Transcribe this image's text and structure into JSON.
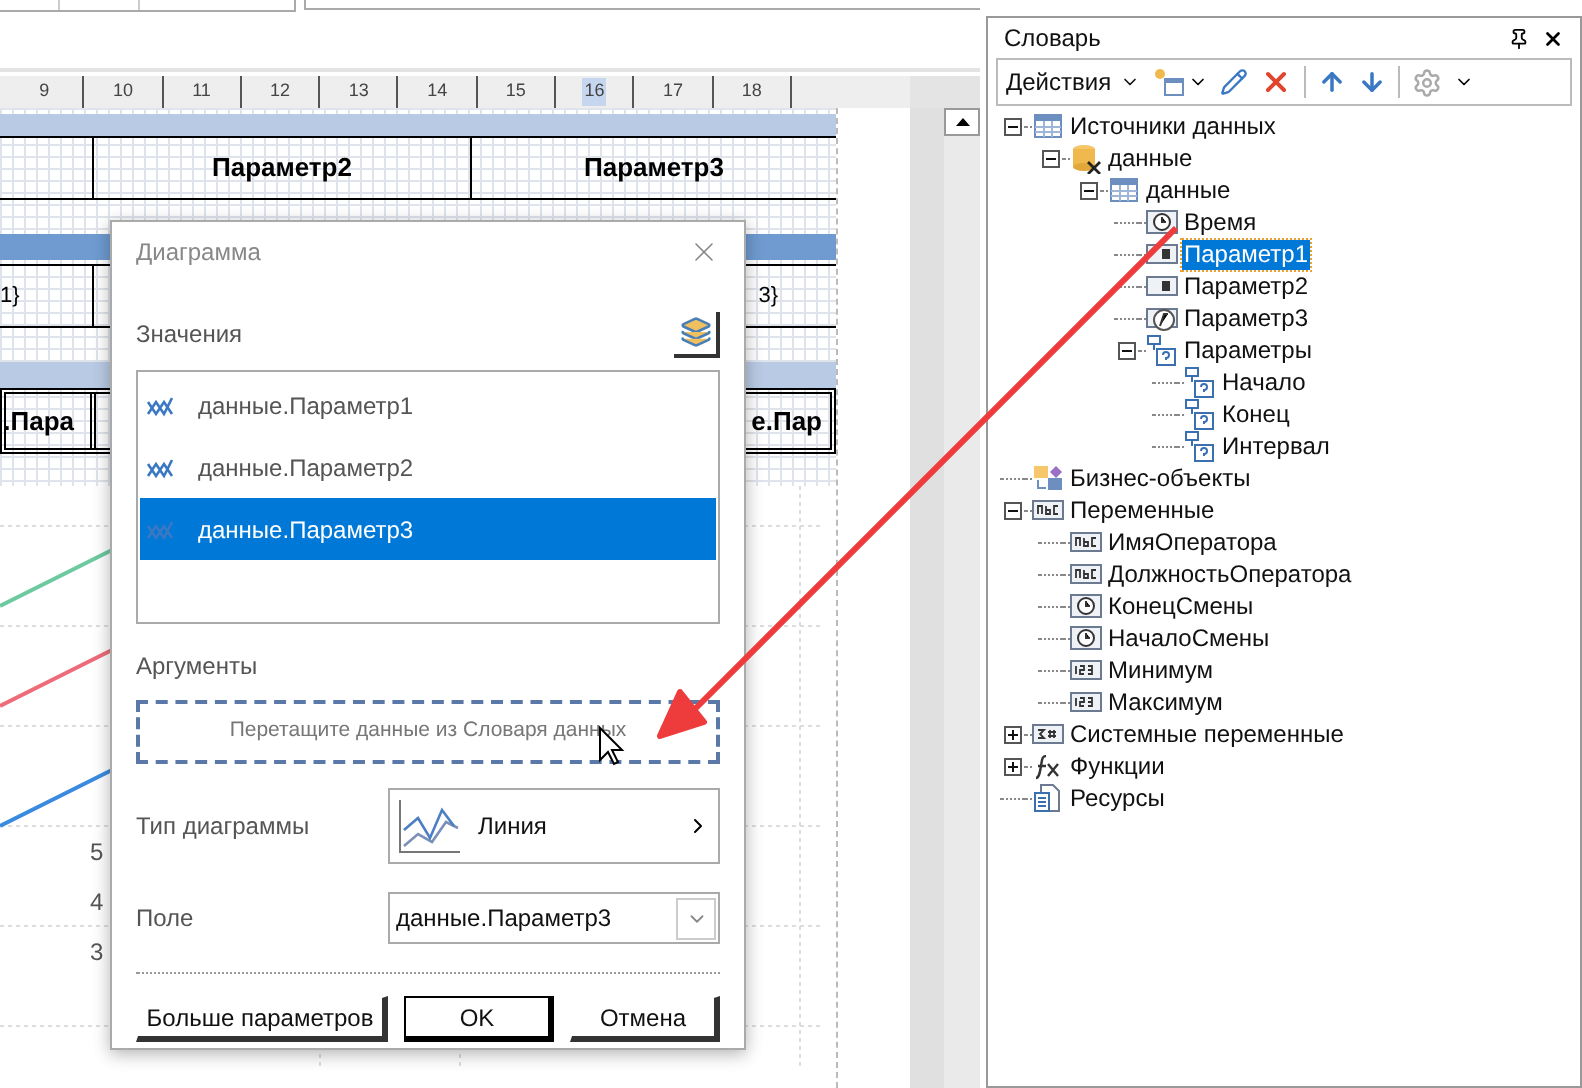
{
  "ruler": {
    "ticks": [
      {
        "label": "9",
        "highlighted": false
      },
      {
        "label": "10",
        "highlighted": false
      },
      {
        "label": "11",
        "highlighted": false
      },
      {
        "label": "12",
        "highlighted": false
      },
      {
        "label": "13",
        "highlighted": false
      },
      {
        "label": "14",
        "highlighted": false
      },
      {
        "label": "15",
        "highlighted": false
      },
      {
        "label": "16",
        "highlighted": true
      },
      {
        "label": "17",
        "highlighted": false
      },
      {
        "label": "18",
        "highlighted": false
      }
    ]
  },
  "report": {
    "header_cells": [
      "Параметр2",
      "Параметр3"
    ],
    "data_cells": [
      "1}",
      "3}"
    ],
    "group_cells": [
      ".Пара",
      "е.Пар"
    ],
    "chart_axis_labels": [
      "5",
      "4",
      "3"
    ]
  },
  "dialog": {
    "title": "Диаграмма",
    "values_label": "Значения",
    "values": [
      {
        "label": "данные.Параметр1",
        "selected": false
      },
      {
        "label": "данные.Параметр2",
        "selected": false
      },
      {
        "label": "данные.Параметр3",
        "selected": true
      }
    ],
    "arguments_label": "Аргументы",
    "arguments_placeholder": "Перетащите данные из Словаря данных",
    "chart_type_label": "Тип диаграммы",
    "chart_type_value": "Линия",
    "field_label": "Поле",
    "field_value": "данные.Параметр3",
    "buttons": [
      {
        "label": "Больше параметров",
        "default": false
      },
      {
        "label": "OK",
        "default": true
      },
      {
        "label": "Отмена",
        "default": false
      }
    ]
  },
  "dictionary": {
    "title": "Словарь",
    "actions_label": "Действия",
    "tree": [
      {
        "label": "Источники данных",
        "kind": "table",
        "expanded": true,
        "selected": false,
        "children": [
          {
            "label": "данные",
            "kind": "database",
            "expanded": true,
            "selected": false,
            "children": [
              {
                "label": "данные",
                "kind": "table",
                "expanded": true,
                "selected": false,
                "children": [
                  {
                    "label": "Время",
                    "kind": "clock",
                    "selected": false
                  },
                  {
                    "label": "Параметр1",
                    "kind": "field",
                    "selected": true
                  },
                  {
                    "label": "Параметр2",
                    "kind": "field",
                    "selected": false
                  },
                  {
                    "label": "Параметр3",
                    "kind": "calc",
                    "selected": false
                  },
                  {
                    "label": "Параметры",
                    "kind": "param",
                    "expanded": true,
                    "selected": false,
                    "children": [
                      {
                        "label": "Начало",
                        "kind": "param",
                        "selected": false
                      },
                      {
                        "label": "Конец",
                        "kind": "param",
                        "selected": false
                      },
                      {
                        "label": "Интервал",
                        "kind": "param",
                        "selected": false
                      }
                    ]
                  }
                ]
              }
            ]
          }
        ]
      },
      {
        "label": "Бизнес-объекты",
        "kind": "business",
        "selected": false
      },
      {
        "label": "Переменные",
        "kind": "variables",
        "expanded": true,
        "selected": false,
        "children": [
          {
            "label": "ИмяОператора",
            "kind": "string",
            "selected": false
          },
          {
            "label": "ДолжностьОператора",
            "kind": "string",
            "selected": false
          },
          {
            "label": "КонецСмены",
            "kind": "clock",
            "selected": false
          },
          {
            "label": "НачалоСмены",
            "kind": "clock",
            "selected": false
          },
          {
            "label": "Минимум",
            "kind": "number",
            "selected": false
          },
          {
            "label": "Максимум",
            "kind": "number",
            "selected": false
          }
        ]
      },
      {
        "label": "Системные переменные",
        "kind": "system",
        "expanded": false,
        "selected": false
      },
      {
        "label": "Функции",
        "kind": "functions",
        "expanded": false,
        "selected": false
      },
      {
        "label": "Ресурсы",
        "kind": "resources",
        "selected": false
      }
    ]
  }
}
